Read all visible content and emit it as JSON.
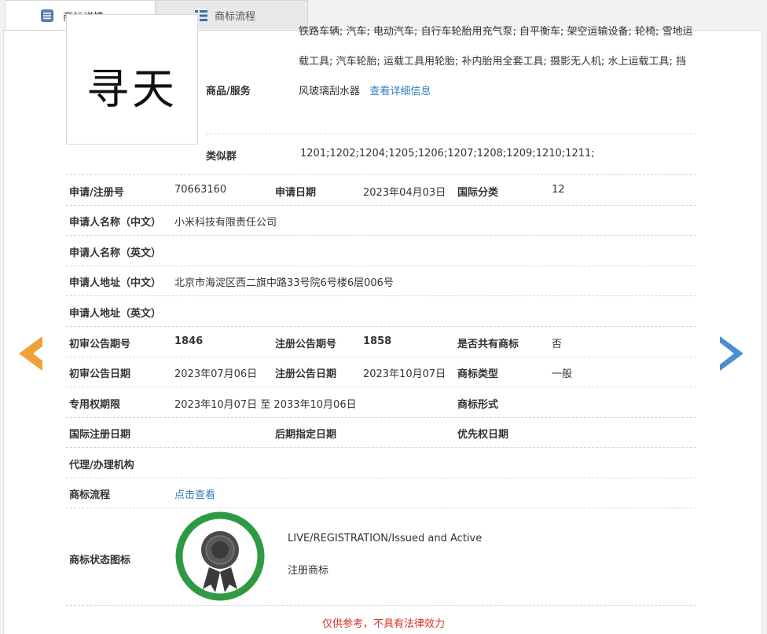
{
  "tabs": [
    {
      "label": "商标详情",
      "icon": "document-list-icon",
      "active": true
    },
    {
      "label": "商标流程",
      "icon": "grid-list-icon",
      "active": false
    }
  ],
  "logo": {
    "text": "寻天"
  },
  "goods": {
    "label": "商品/服务",
    "text": "铁路车辆; 汽车; 电动汽车; 自行车轮胎用充气泵; 自平衡车; 架空运输设备; 轮椅; 雪地运载工具; 汽车轮胎; 运载工具用轮胎; 补内胎用全套工具; 摄影无人机; 水上运载工具; 挡风玻璃刮水器",
    "link": "查看详细信息"
  },
  "similar_group": {
    "label": "类似群",
    "value": "1201;1202;1204;1205;1206;1207;1208;1209;1210;1211;"
  },
  "fields": {
    "reg_no": {
      "label": "申请/注册号",
      "value": "70663160"
    },
    "app_date": {
      "label": "申请日期",
      "value": "2023年04月03日"
    },
    "intl_class": {
      "label": "国际分类",
      "value": "12"
    },
    "applicant_cn": {
      "label": "申请人名称（中文）",
      "value": "小米科技有限责任公司"
    },
    "applicant_en": {
      "label": "申请人名称（英文）",
      "value": ""
    },
    "address_cn": {
      "label": "申请人地址（中文）",
      "value": "北京市海淀区西二旗中路33号院6号楼6层006号"
    },
    "address_en": {
      "label": "申请人地址（英文）",
      "value": ""
    },
    "prelim_no": {
      "label": "初审公告期号",
      "value": "1846"
    },
    "reg_pub_no": {
      "label": "注册公告期号",
      "value": "1858"
    },
    "shared": {
      "label": "是否共有商标",
      "value": "否"
    },
    "prelim_date": {
      "label": "初审公告日期",
      "value": "2023年07月06日"
    },
    "reg_pub_date": {
      "label": "注册公告日期",
      "value": "2023年10月07日"
    },
    "tm_type": {
      "label": "商标类型",
      "value": "一般"
    },
    "exclusive_period": {
      "label": "专用权期限",
      "value": "2023年10月07日 至 2033年10月06日"
    },
    "tm_form": {
      "label": "商标形式",
      "value": ""
    },
    "intl_reg_date": {
      "label": "国际注册日期",
      "value": ""
    },
    "later_date": {
      "label": "后期指定日期",
      "value": ""
    },
    "priority_date": {
      "label": "优先权日期",
      "value": ""
    },
    "agent": {
      "label": "代理/办理机构",
      "value": ""
    },
    "process": {
      "label": "商标流程",
      "link": "点击查看"
    },
    "status_icon": {
      "label": "商标状态图标",
      "status_en": "LIVE/REGISTRATION/Issued and Active",
      "status_cn": "注册商标"
    }
  },
  "disclaimer": "仅供参考，不具有法律效力",
  "colors": {
    "link": "#2f7fc1",
    "badge_green": "#2e9b44",
    "arrow_left": "#f0a236",
    "arrow_right": "#4a8fd0",
    "disclaimer": "#d9302b"
  }
}
